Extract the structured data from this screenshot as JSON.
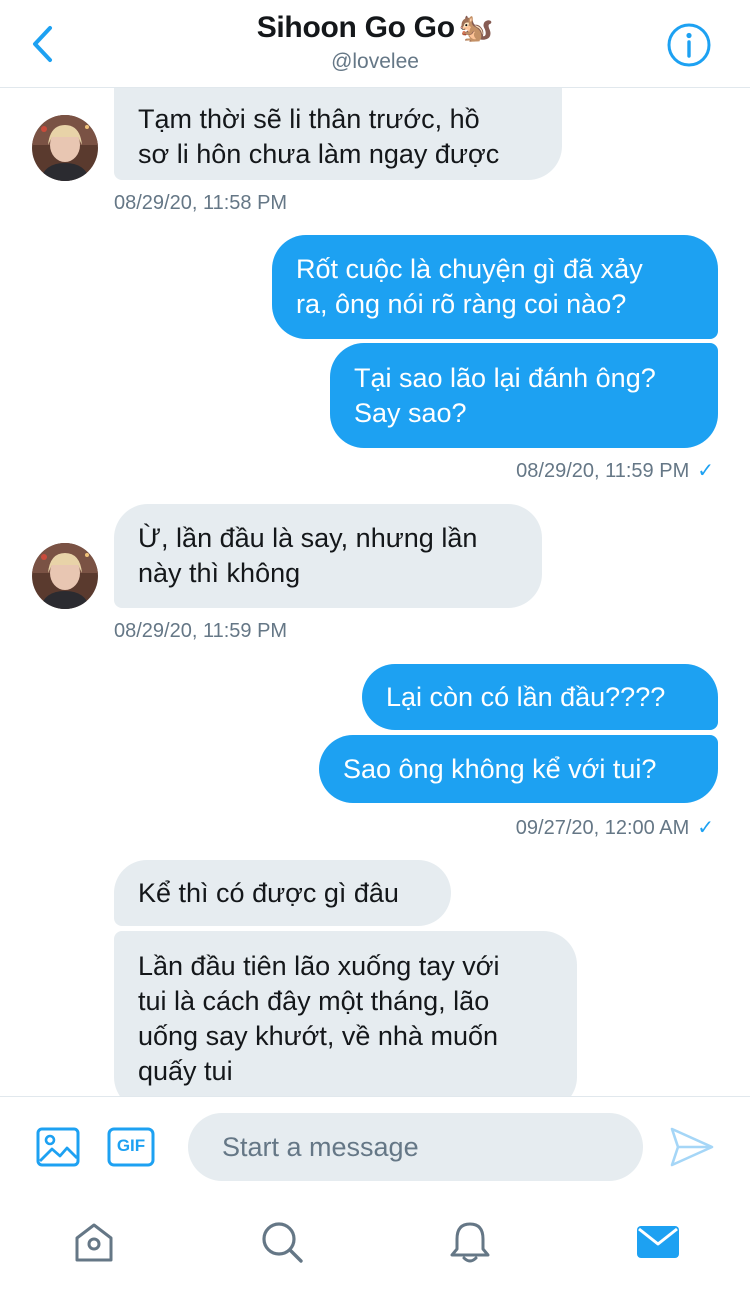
{
  "header": {
    "back_icon": "chevron-left-icon",
    "title": "Sihoon Go Go",
    "title_emoji": "🐿️",
    "handle": "@lovelee",
    "info_icon": "info-icon"
  },
  "messages": [
    {
      "id": "m1",
      "direction": "in",
      "lines": [
        "Tạm thời sẽ li thân trước, hồ",
        "sơ li hôn chưa làm ngay được"
      ]
    },
    {
      "id": "t1",
      "type": "timestamp",
      "text": "08/29/20, 11:58 PM"
    },
    {
      "id": "m2",
      "direction": "out",
      "lines": [
        "Rốt cuộc là chuyện gì đã xảy",
        "ra, ông nói rõ ràng coi nào?"
      ]
    },
    {
      "id": "m3",
      "direction": "out",
      "lines": [
        "Tại sao lão lại đánh ông?",
        "Say sao?"
      ]
    },
    {
      "id": "t2",
      "type": "timestamp",
      "text": "08/29/20, 11:59 PM",
      "read_mark": "✓"
    },
    {
      "id": "m4",
      "direction": "in",
      "lines": [
        "Ừ, lần đầu là say, nhưng lần",
        "này thì không"
      ]
    },
    {
      "id": "t3",
      "type": "timestamp",
      "text": "08/29/20, 11:59 PM"
    },
    {
      "id": "m5",
      "direction": "out",
      "lines": [
        "Lại còn có lần đầu????"
      ]
    },
    {
      "id": "m6",
      "direction": "out",
      "lines": [
        "Sao ông không kể với tui?"
      ]
    },
    {
      "id": "t4",
      "type": "timestamp",
      "text": "09/27/20, 12:00 AM",
      "read_mark": "✓"
    },
    {
      "id": "m7",
      "direction": "in",
      "lines": [
        "Kể thì có được gì đâu"
      ]
    },
    {
      "id": "m8",
      "direction": "in",
      "lines": [
        "Lần đầu tiên lão xuống tay với",
        "tui là cách đây một tháng, lão",
        "uống say khướt, về nhà muốn",
        "quấy tui"
      ]
    }
  ],
  "composer": {
    "image_icon": "image-icon",
    "gif_label": "GIF",
    "placeholder": "Start a message",
    "send_icon": "send-icon"
  },
  "tabbar": {
    "items": [
      "home-icon",
      "search-icon",
      "bell-icon",
      "mail-icon"
    ],
    "active": "mail-icon"
  },
  "colors": {
    "accent": "#1da1f2",
    "incoming_bubble": "#e6ecf0",
    "secondary_text": "#657786"
  }
}
